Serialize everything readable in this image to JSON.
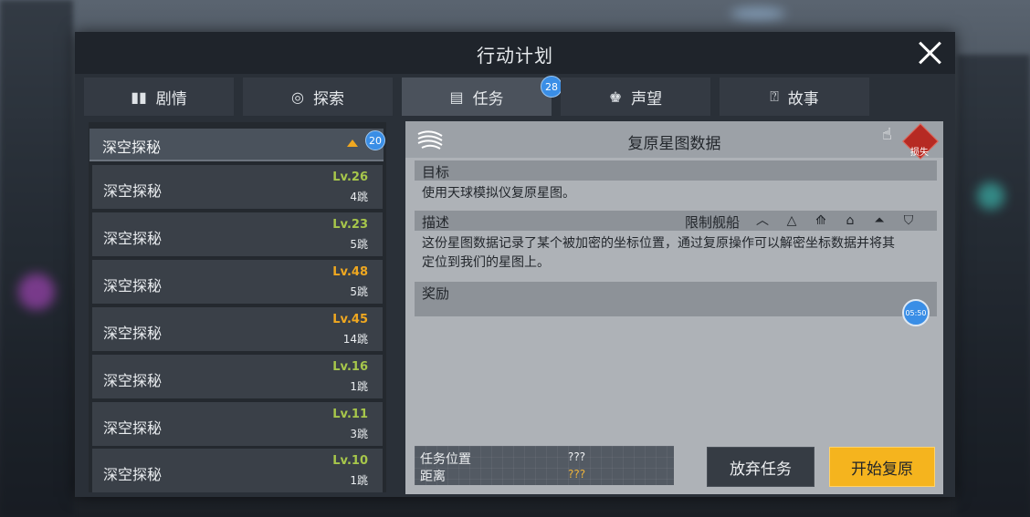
{
  "window": {
    "title": "行动计划"
  },
  "tabs": [
    {
      "label": "剧情",
      "icon": "book-icon"
    },
    {
      "label": "探索",
      "icon": "explore-icon"
    },
    {
      "label": "任务",
      "icon": "task-list-icon",
      "badge": "28"
    },
    {
      "label": "声望",
      "icon": "reputation-icon"
    },
    {
      "label": "故事",
      "icon": "story-icon"
    }
  ],
  "list": {
    "header": {
      "label": "深空探秘",
      "badge": "20"
    },
    "items": [
      {
        "name": "深空探秘",
        "level": "Lv.26",
        "jumps": "4跳",
        "level_color": "green"
      },
      {
        "name": "深空探秘",
        "level": "Lv.23",
        "jumps": "5跳",
        "level_color": "green"
      },
      {
        "name": "深空探秘",
        "level": "Lv.48",
        "jumps": "5跳",
        "level_color": "orange"
      },
      {
        "name": "深空探秘",
        "level": "Lv.45",
        "jumps": "14跳",
        "level_color": "orange"
      },
      {
        "name": "深空探秘",
        "level": "Lv.16",
        "jumps": "1跳",
        "level_color": "green"
      },
      {
        "name": "深空探秘",
        "level": "Lv.11",
        "jumps": "3跳",
        "level_color": "green"
      },
      {
        "name": "深空探秘",
        "level": "Lv.10",
        "jumps": "1跳",
        "level_color": "green"
      }
    ]
  },
  "detail": {
    "title": "复原星图数据",
    "loss_badge": "损失",
    "objective_label": "目标",
    "objective_text": "使用天球模拟仪复原星图。",
    "description_label": "描述",
    "restrict_label": "限制舰船",
    "ship_icons": [
      "frigate-icon",
      "destroyer-icon",
      "cruiser-icon",
      "battlecruiser-icon",
      "battleship-icon",
      "carrier-icon"
    ],
    "description_line1": "这份星图数据记录了某个被加密的坐标位置，通过复原操作可以解密坐标数据并将其",
    "description_line2": "定位到我们的星图上。",
    "reward_label": "奖励",
    "timer": "05:50",
    "location_label": "任务位置",
    "location_value": "???",
    "distance_label": "距离",
    "distance_value": "???",
    "abandon_label": "放弃任务",
    "start_label": "开始复原"
  },
  "colors": {
    "accent": "#f5b41e",
    "badge": "#3a8ee6",
    "level_green": "#a7c74b",
    "level_orange": "#f0a820",
    "danger": "#b62a23"
  }
}
